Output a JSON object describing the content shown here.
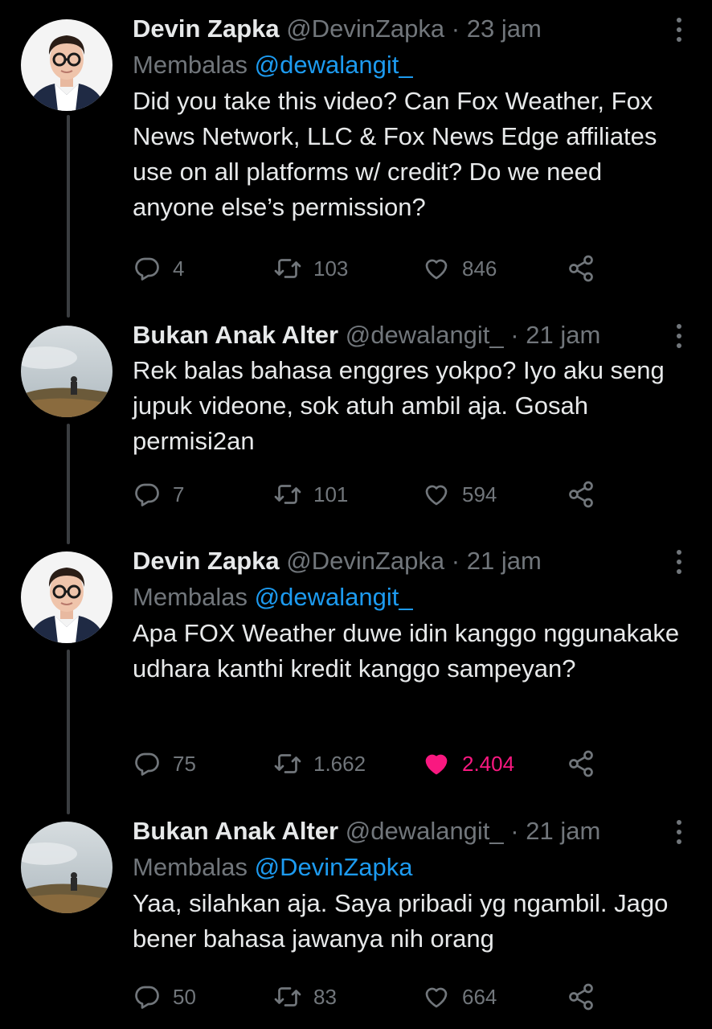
{
  "tweets": [
    {
      "name": "Devin Zapka",
      "handle": "@DevinZapka",
      "dot": "·",
      "time": "23 jam",
      "replying_label": "Membalas",
      "replying_to": "@dewalangit_",
      "text": "Did you take this video? Can Fox Weather, Fox News Network, LLC & Fox News Edge affiliates use on all platforms w/ credit?  Do we need anyone else’s permission?",
      "replies": "4",
      "retweets": "103",
      "likes": "846",
      "liked": false,
      "avatar": "man-with-glasses"
    },
    {
      "name": "Bukan Anak Alter",
      "handle": "@dewalangit_",
      "dot": "·",
      "time": "21 jam",
      "text": "Rek balas bahasa enggres yokpo? Iyo aku seng jupuk videone, sok atuh ambil aja. Gosah permisi2an",
      "replies": "7",
      "retweets": "101",
      "likes": "594",
      "liked": false,
      "avatar": "misty-hill-landscape"
    },
    {
      "name": "Devin Zapka",
      "handle": "@DevinZapka",
      "dot": "·",
      "time": "21 jam",
      "replying_label": "Membalas",
      "replying_to": "@dewalangit_",
      "text": "Apa FOX Weather duwe idin kanggo nggunakake udhara kanthi kredit kanggo sampeyan?",
      "replies": "75",
      "retweets": "1.662",
      "likes": "2.404",
      "liked": true,
      "avatar": "man-with-glasses"
    },
    {
      "name": "Bukan Anak Alter",
      "handle": "@dewalangit_",
      "dot": "·",
      "time": "21 jam",
      "replying_label": "Membalas",
      "replying_to": "@DevinZapka",
      "text": "Yaa, silahkan aja. Saya pribadi yg ngambil. Jago bener bahasa jawanya nih orang",
      "replies": "50",
      "retweets": "83",
      "likes": "664",
      "liked": false,
      "avatar": "misty-hill-landscape"
    }
  ],
  "colors": {
    "background": "#000000",
    "text": "#e7e9ea",
    "muted": "#71767b",
    "link": "#1d9bf0",
    "like": "#f91880",
    "thread_line": "#3a3d40"
  },
  "icons": [
    "reply-icon",
    "retweet-icon",
    "like-icon",
    "share-icon",
    "more-icon"
  ]
}
